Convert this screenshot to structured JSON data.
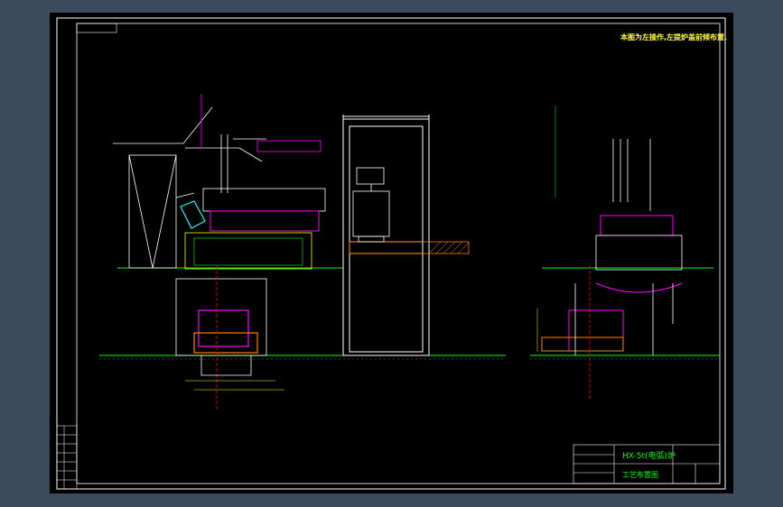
{
  "drawing": {
    "note": "本图为左操作,左提炉盖前倾布置.",
    "title_main": "HX-5t(电弧)炉",
    "title_sub": "工艺布置图"
  },
  "colors": {
    "paper": "#000000",
    "frame": "#ffffff",
    "accent_magenta": "#ff00ff",
    "accent_cyan": "#00ffff",
    "accent_green": "#00ff00",
    "accent_yellow": "#ffff00",
    "accent_orange": "#ff8000",
    "hatch": "#ff8000"
  }
}
